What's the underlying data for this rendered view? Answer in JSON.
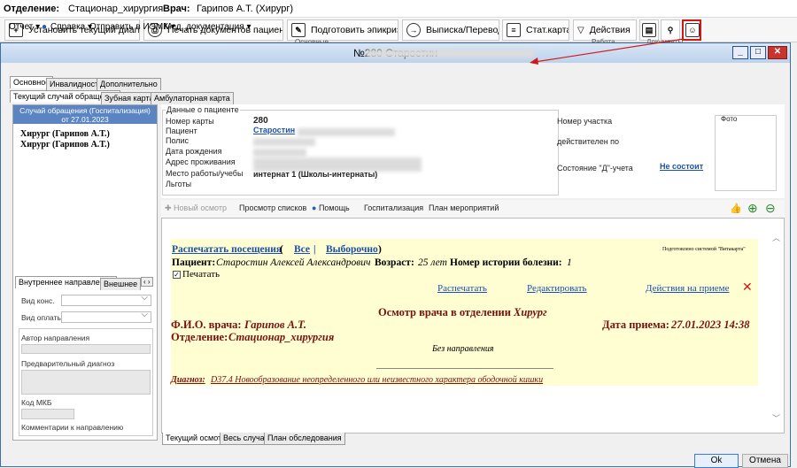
{
  "info_bar": {
    "dept_label": "Отделение:",
    "dept_value": "Стационар_хирургия",
    "doctor_label": "Врач:",
    "doctor_value": "Гарипов А.Т. (Хирург)"
  },
  "toolbar": {
    "set_diagnosis": "Установить текущий диагноз",
    "print_docs": "Печать документов пациента",
    "prepare_epicrisis": "Подготовить эпикриз",
    "discharge": "Выписка/Перевод",
    "stat_card": "Стат.карта",
    "actions": "Действия",
    "groups": [
      "Основные",
      "Работа",
      "Документы"
    ]
  },
  "window": {
    "title": "№280 Старостин"
  },
  "menu": [
    "Отчет ▾",
    "Справка ▾",
    "Отправить в ИЭМК ▾",
    "Мед. документация ▾"
  ],
  "tabs_top": [
    "Основное",
    "Инвалидность",
    "Дополнительно"
  ],
  "tabs_sub": [
    "Текущий случай обращения",
    "Зубная карта",
    "Амбулаторная карта"
  ],
  "left": {
    "case_header_1": "Случай обращения (Госпитализация)",
    "case_header_2": "от 27.01.2023",
    "tree": [
      "Хирург (Гарипов А.Т.)",
      "Хирург (Гарипов А.Т.)"
    ],
    "tab_internal": "Внутреннее направление",
    "tab_external": "Внешнее на",
    "vid_kons": "Вид конс.",
    "vid_oplaty": "Вид оплаты",
    "author": "Автор направления",
    "prelim_diag": "Предварительный диагноз",
    "mkb_code": "Код МКБ",
    "comments": "Комментарии к направлению"
  },
  "patient": {
    "section": "Данные о пациенте",
    "card_no_label": "Номер карты",
    "card_no": "280",
    "patient_label": "Пациент",
    "patient_name": "Старостин",
    "policy_label": "Полис",
    "dob_label": "Дата рождения",
    "address_label": "Адрес проживания",
    "work_label": "Место работы/учебы",
    "work_value": "интернат 1 (Школы-интернаты)",
    "benefits_label": "Льготы",
    "district_label": "Номер участка",
    "valid_label": "действителен по",
    "d_status_label": "Состояние \"Д\"-учета",
    "d_status_value": "Не состоит",
    "photo": "Фото"
  },
  "doc_toolbar": [
    "Новый осмотр",
    "Просмотр списков",
    "Помощь",
    "Госпитализация",
    "План мероприятий"
  ],
  "doc": {
    "print_visits": "Распечатать посещения",
    "paren_open": "(",
    "all": "Все",
    "sep": "|",
    "selective": "Выборочно",
    "paren_close": ")",
    "prepared_by": "Подготовлено системой \"Витакарта\"",
    "patient_label": "Пациент:",
    "patient_name": "Старостин Алексей Александрович",
    "age_label": "Возраст:",
    "age": "25 лет",
    "history_label": "Номер истории болезни:",
    "history_no": "1",
    "print_check": "Печатать",
    "print_link": "Распечатать",
    "edit_link": "Редактировать",
    "actions_link": "Действия на приеме",
    "exam_title": "Осмотр врача в отделении",
    "exam_title_spec": "Хирург",
    "doctor_label": "Ф.И.О. врача:",
    "doctor_name": "Гарипов А.Т.",
    "date_label": "Дата приема:",
    "date_value": "27.01.2023 14:38",
    "dept_label": "Отделение:",
    "dept_value": "Стационар_хирургия",
    "no_referral": "Без направления",
    "diag_label": "Диагноз:",
    "diag_text": "D37.4 Новообразование неопределенного или неизвестного характера ободочной кишки"
  },
  "bottom_tabs": [
    "Текущий осмотр",
    "Весь случай",
    "План обследования"
  ],
  "buttons": {
    "ok": "Ok",
    "cancel": "Отмена"
  },
  "colors": {
    "case_header": "#5b85c2",
    "yellow": "#fefed2",
    "maroon": "#7a1010",
    "link": "#1a4fb0",
    "arrow": "#d01818"
  }
}
